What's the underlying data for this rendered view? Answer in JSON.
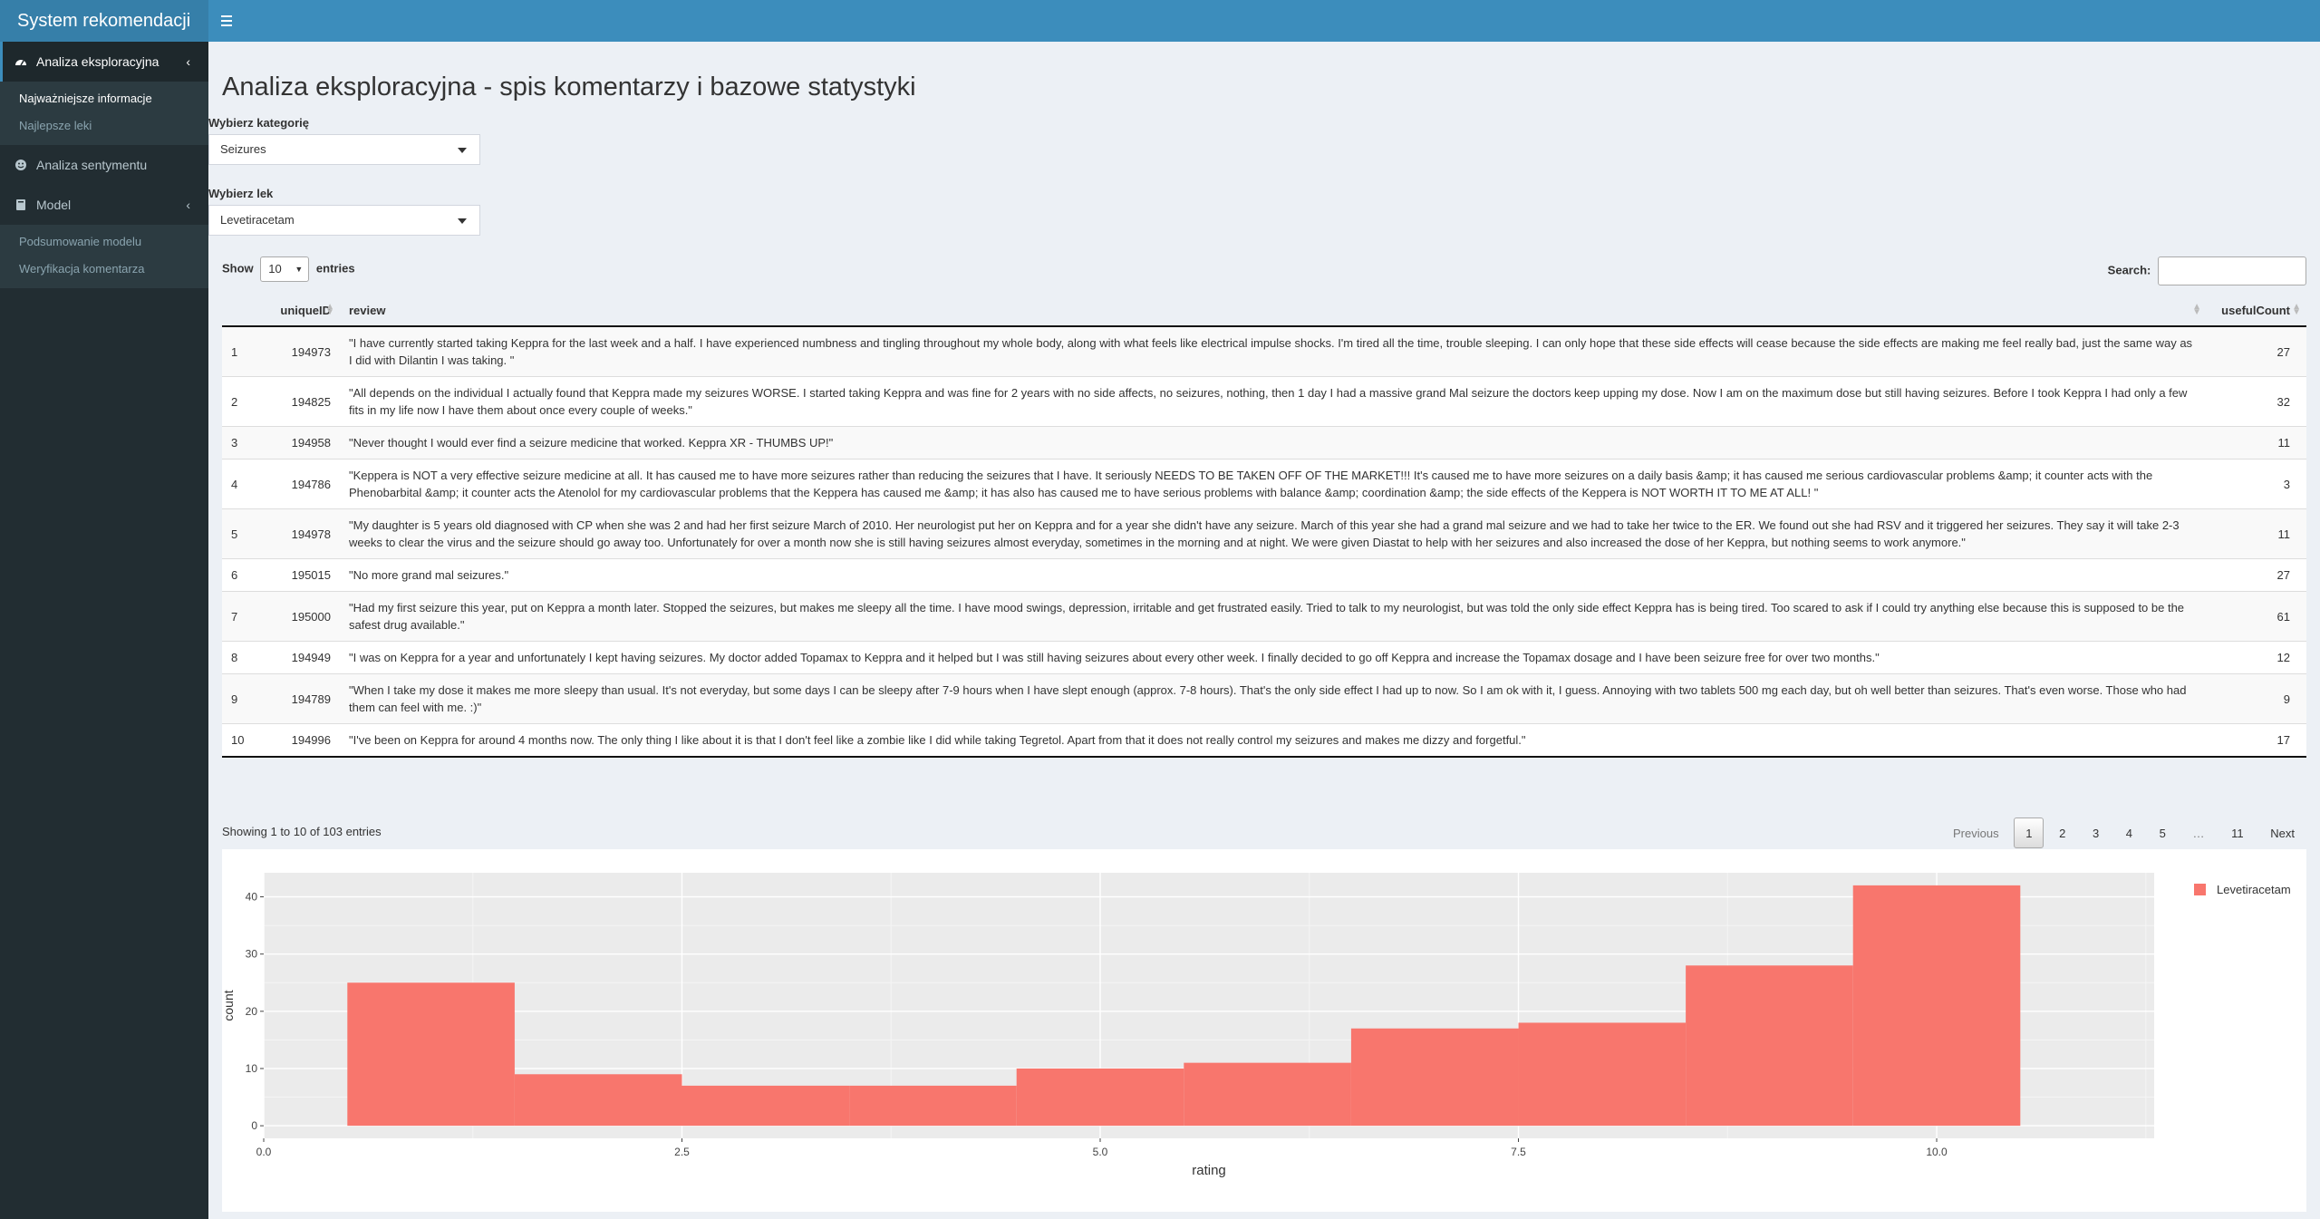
{
  "app": {
    "title": "System rekomendacji"
  },
  "sidebar": {
    "items": [
      {
        "label": "Analiza eksploracyjna",
        "icon": "dashboard-icon",
        "active": true
      },
      {
        "label": "Analiza sentymentu",
        "icon": "smile-icon"
      },
      {
        "label": "Model",
        "icon": "book-icon"
      }
    ],
    "sub1": [
      "Najważniejsze informacje",
      "Najlepsze leki"
    ],
    "sub2": [
      "Podsumowanie modelu",
      "Weryfikacja komentarza"
    ]
  },
  "main": {
    "title": "Analiza eksploracyjna - spis komentarzy i bazowe statystyki",
    "category_label": "Wybierz kategorię",
    "category_value": "Seizures",
    "drug_label": "Wybierz lek",
    "drug_value": "Levetiracetam"
  },
  "table": {
    "show_label": "Show",
    "entries_value": "10",
    "entries_label": "entries",
    "search_label": "Search:",
    "columns": [
      "",
      "uniqueID",
      "review",
      "usefulCount"
    ],
    "rows": [
      [
        "1",
        "194973",
        "\"I have currently started taking Keppra for the last week and a half. I have experienced numbness and tingling throughout my whole body, along with what feels like electrical impulse shocks. I'm tired all the time, trouble sleeping. I can only hope that these side effects will cease because the side effects are making me feel really bad, just the same way as I did with Dilantin I was taking. \"",
        "27"
      ],
      [
        "2",
        "194825",
        "\"All depends on the individual I actually found that Keppra made my seizures WORSE. I started taking Keppra and was fine for 2 years with no side affects, no seizures, nothing, then 1 day I had a massive grand Mal seizure the doctors keep upping my dose. Now I am on the maximum dose but still having seizures. Before I took Keppra I had only a few fits in my life now I have them about once every couple of weeks.\"",
        "32"
      ],
      [
        "3",
        "194958",
        "\"Never thought I would ever find a seizure medicine that worked. Keppra XR - THUMBS UP!\"",
        "11"
      ],
      [
        "4",
        "194786",
        "\"Keppera is NOT a very effective seizure medicine at all. It has caused me to have more seizures rather than reducing the seizures that I have. It seriously NEEDS TO BE TAKEN OFF OF THE MARKET!!! It's caused me to have more seizures on a daily basis &amp; it has caused me serious cardiovascular problems &amp; it counter acts with the Phenobarbital &amp; it counter acts the Atenolol for my cardiovascular problems that the Keppera has caused me &amp; it has also has caused me to have serious problems with balance &amp; coordination &amp; the side effects of the Keppera is NOT WORTH IT TO ME AT ALL! \"",
        "3"
      ],
      [
        "5",
        "194978",
        "\"My daughter is 5 years old diagnosed with CP when she was 2 and had her first seizure March of 2010. Her neurologist put her on Keppra and for a year she didn't have any seizure. March of this year she had a grand mal seizure and we had to take her twice to the ER. We found out she had RSV and it triggered her seizures. They say it will take 2-3 weeks to clear the virus and the seizure should go away too. Unfortunately for over a month now she is still having seizures almost everyday, sometimes in the morning and at night. We were given Diastat to help with her seizures and also increased the dose of her Keppra, but nothing seems to work anymore.\"",
        "11"
      ],
      [
        "6",
        "195015",
        "\"No more grand mal seizures.\"",
        "27"
      ],
      [
        "7",
        "195000",
        "\"Had my first seizure this year, put on Keppra a month later. Stopped the seizures, but makes me sleepy all the time. I have mood swings, depression, irritable and get frustrated easily. Tried to talk to my neurologist, but was told the only side effect Keppra has is being tired. Too scared to ask if I could try anything else because this is supposed to be the safest drug available.\"",
        "61"
      ],
      [
        "8",
        "194949",
        "\"I was on Keppra for a year and unfortunately I kept having seizures. My doctor added Topamax to Keppra and it helped but I was still having seizures about every other week. I finally decided to go off Keppra and increase the Topamax dosage and I have been seizure free for over two months.\"",
        "12"
      ],
      [
        "9",
        "194789",
        "\"When I take my dose it makes me more sleepy than usual. It's not everyday, but some days I can be sleepy after 7-9 hours when I have slept enough (approx. 7-8 hours). That's the only side effect I had up to now. So I am ok with it, I guess. Annoying with two tablets 500 mg each day, but oh well better than seizures. That's even worse. Those who had them can feel with me. :)\"",
        "9"
      ],
      [
        "10",
        "194996",
        "\"I've been on Keppra for around 4 months now. The only thing I like about it is that I don't feel like a zombie like I did while taking Tegretol. Apart from that it does not really control my seizures and makes me dizzy and forgetful.\"",
        "17"
      ]
    ],
    "info": "Showing 1 to 10 of 103 entries",
    "pagination": [
      "Previous",
      "1",
      "2",
      "3",
      "4",
      "5",
      "…",
      "11",
      "Next"
    ]
  },
  "chart_data": {
    "type": "bar",
    "title": "",
    "xlabel": "rating",
    "ylabel": "count",
    "xlim": [
      0,
      11.3
    ],
    "ylim": [
      -2.2,
      44.2
    ],
    "xticks": [
      "0.0",
      "2.5",
      "5.0",
      "7.5",
      "10.0"
    ],
    "xtick_values": [
      0,
      2.5,
      5,
      7.5,
      10
    ],
    "yticks": [
      "0",
      "10",
      "20",
      "30",
      "40"
    ],
    "ytick_values": [
      0,
      10,
      20,
      30,
      40
    ],
    "bins": [
      {
        "x0": 0.5,
        "x1": 1.5,
        "count": 25
      },
      {
        "x0": 1.5,
        "x1": 2.5,
        "count": 9
      },
      {
        "x0": 2.5,
        "x1": 3.5,
        "count": 7
      },
      {
        "x0": 3.5,
        "x1": 4.5,
        "count": 7
      },
      {
        "x0": 4.5,
        "x1": 5.5,
        "count": 10
      },
      {
        "x0": 5.5,
        "x1": 6.5,
        "count": 11
      },
      {
        "x0": 6.5,
        "x1": 7.5,
        "count": 17
      },
      {
        "x0": 7.5,
        "x1": 8.5,
        "count": 18
      },
      {
        "x0": 8.5,
        "x1": 9.5,
        "count": 28
      },
      {
        "x0": 9.5,
        "x1": 10.5,
        "count": 42
      }
    ],
    "series": [
      {
        "name": "Levetiracetam",
        "color": "#F8766D"
      }
    ],
    "legend": "top-right",
    "grid": true
  }
}
